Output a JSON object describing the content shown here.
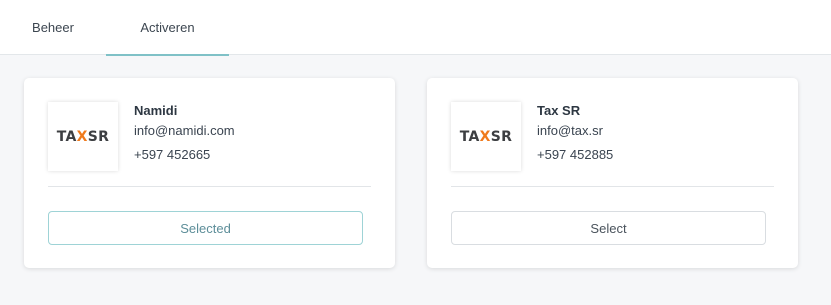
{
  "tabs": [
    {
      "label": "Beheer",
      "active": false
    },
    {
      "label": "Activeren",
      "active": true
    }
  ],
  "colors": {
    "accent": "#7fc1c7",
    "logo_accent": "#f07a1c"
  },
  "companies": [
    {
      "logo": {
        "left": "TA",
        "mark": "X",
        "right": "SR"
      },
      "name": "Namidi",
      "email": "info@namidi.com",
      "phone": "+597 452665",
      "button_label": "Selected",
      "selected": true
    },
    {
      "logo": {
        "left": "TA",
        "mark": "X",
        "right": "SR"
      },
      "name": "Tax SR",
      "email": "info@tax.sr",
      "phone": "+597 452885",
      "button_label": "Select",
      "selected": false
    }
  ]
}
